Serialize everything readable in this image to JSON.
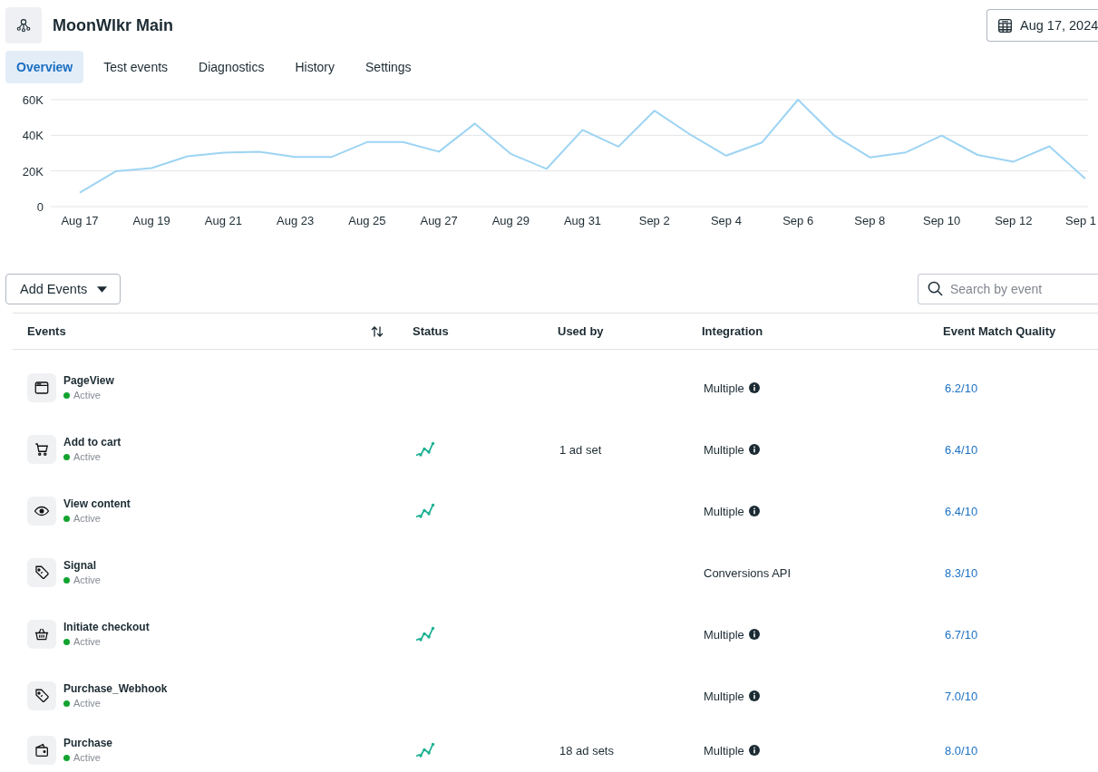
{
  "header": {
    "title": "MoonWlkr Main",
    "date": "Aug 17, 2024"
  },
  "tabs": [
    {
      "label": "Overview",
      "selected": true
    },
    {
      "label": "Test events",
      "selected": false
    },
    {
      "label": "Diagnostics",
      "selected": false
    },
    {
      "label": "History",
      "selected": false
    },
    {
      "label": "Settings",
      "selected": false
    }
  ],
  "chart": {
    "chart_data": {
      "type": "line",
      "categories": [
        "Aug 17",
        null,
        "Aug 19",
        null,
        "Aug 21",
        null,
        "Aug 23",
        null,
        "Aug 25",
        null,
        "Aug 27",
        null,
        "Aug 29",
        null,
        "Aug 31",
        null,
        "Sep 2",
        null,
        "Sep 4",
        null,
        "Sep 6",
        null,
        "Sep 8",
        null,
        "Sep 10",
        null,
        "Sep 12",
        null,
        "Sep 1"
      ],
      "values": [
        7800,
        19800,
        21600,
        28200,
        30200,
        30800,
        27800,
        27800,
        36200,
        36200,
        30800,
        46600,
        29600,
        21200,
        43000,
        33600,
        53800,
        40400,
        28600,
        36000,
        60000,
        40000,
        27600,
        30400,
        39800,
        29000,
        25200,
        33800,
        15600
      ],
      "ylim": [
        0,
        60000
      ],
      "yticks": [
        {
          "value": 0,
          "label": "0"
        },
        {
          "value": 20000,
          "label": "20K"
        },
        {
          "value": 40000,
          "label": "40K"
        },
        {
          "value": 60000,
          "label": "60K"
        }
      ],
      "grid": true
    }
  },
  "toolbar": {
    "add_button": "Add Events",
    "search": {
      "placeholder": "Search by event"
    }
  },
  "table": {
    "columns": [
      {
        "label": "Events",
        "sortable": true
      },
      {
        "label": "Status",
        "sortable": false
      },
      {
        "label": "Used by",
        "sortable": false
      },
      {
        "label": "Integration",
        "sortable": false
      },
      {
        "label": "Event Match Quality",
        "sortable": false
      }
    ],
    "rows": [
      {
        "name": "PageView",
        "status": "Active",
        "trend": false,
        "integration": "Multiple",
        "info": true,
        "quality": "6.2/10"
      },
      {
        "name": "Add to cart",
        "status": "Active",
        "trend": true,
        "used_by": "1 ad set",
        "integration": "Multiple",
        "info": true,
        "quality": "6.4/10"
      },
      {
        "name": "View content",
        "status": "Active",
        "trend": true,
        "integration": "Multiple",
        "info": true,
        "quality": "6.4/10"
      },
      {
        "name": "Signal",
        "status": "Active",
        "trend": false,
        "integration": "Conversions API",
        "info": false,
        "quality": "8.3/10"
      },
      {
        "name": "Initiate checkout",
        "status": "Active",
        "trend": true,
        "integration": "Multiple",
        "info": true,
        "quality": "6.7/10"
      },
      {
        "name": "Purchase_Webhook",
        "status": "Active",
        "trend": false,
        "integration": "Multiple",
        "info": true,
        "quality": "7.0/10"
      },
      {
        "name": "Purchase",
        "status": "Active",
        "trend": true,
        "used_by": "18 ad sets",
        "integration": "Multiple",
        "info": true,
        "quality": "8.0/10"
      }
    ]
  }
}
